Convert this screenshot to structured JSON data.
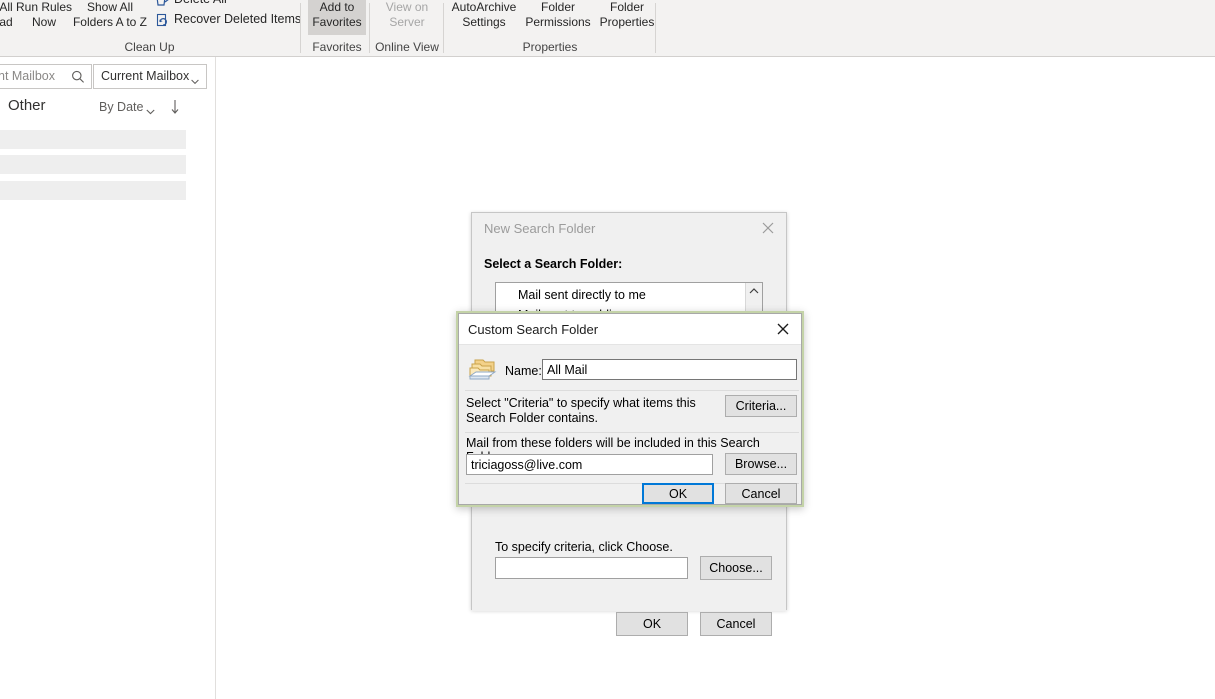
{
  "ribbon": {
    "groups": [
      {
        "label": "Clean Up"
      },
      {
        "label": "Favorites"
      },
      {
        "label": "Online View"
      },
      {
        "label": "Properties"
      }
    ],
    "buttons": {
      "mark_all_as_read": "All\nad",
      "run_rules_now": "Run Rules\nNow",
      "show_all_folders": "Show All\nFolders A to Z",
      "delete_all": "Delete All",
      "recover_deleted_items": "Recover Deleted Items",
      "add_to_favorites": "Add to\nFavorites",
      "view_on_server": "View on\nServer",
      "autoarchive_settings": "AutoArchive\nSettings",
      "folder_permissions": "Folder\nPermissions",
      "folder_properties": "Folder\nProperties"
    }
  },
  "left_pane": {
    "search_placeholder": "nt Mailbox",
    "scope_label": "Current Mailbox",
    "focused_other_tab": "Other",
    "sort_label": "By Date",
    "message_rows": 3
  },
  "new_search_folder_dialog": {
    "title": "New Search Folder",
    "select_label": "Select a Search Folder:",
    "list_items": [
      "Mail sent directly to me",
      "Mail sent to public groups"
    ],
    "criteria_hint": "To specify criteria, click Choose.",
    "criteria_value": "",
    "choose_button": "Choose...",
    "ok_button": "OK",
    "cancel_button": "Cancel",
    "close_icon": "close-icon",
    "scroll_up_icon": "chevron-up-icon"
  },
  "custom_search_folder_dialog": {
    "title": "Custom Search Folder",
    "name_label": "Name:",
    "name_value": "All Mail",
    "criteria_text": "Select \"Criteria\" to specify what items this Search Folder contains.",
    "criteria_button": "Criteria...",
    "folders_label": "Mail from these folders will be included in this Search Folder:",
    "folders_value": "triciagoss@live.com",
    "browse_button": "Browse...",
    "ok_button": "OK",
    "cancel_button": "Cancel",
    "close_icon": "close-icon",
    "folder_icon": "folder-stack-icon",
    "focus_color": "#0078d7",
    "border_color": "#c4d3a8"
  }
}
